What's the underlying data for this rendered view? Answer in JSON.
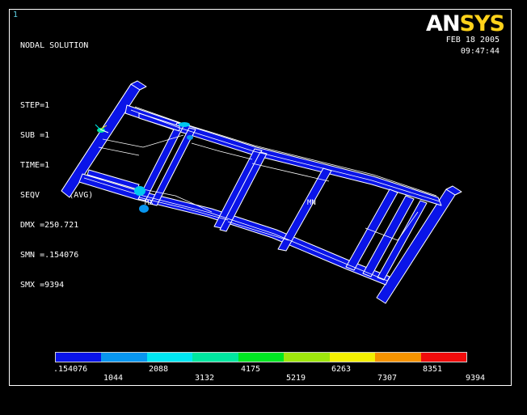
{
  "window_number": "1",
  "logo": {
    "part1": "AN",
    "part2": "SYS"
  },
  "date": "FEB 18 2005",
  "time": "09:47:44",
  "info": [
    "NODAL SOLUTION",
    "",
    "STEP=1",
    "SUB =1",
    "TIME=1",
    "SEQV      (AVG)",
    "DMX =250.721",
    "SMN =.154076",
    "SMX =9394"
  ],
  "markers": {
    "mx": "MX",
    "mn": "MN"
  },
  "legend": {
    "colors": [
      "#0a14e8",
      "#0896ef",
      "#00e6f2",
      "#00e7a0",
      "#00e623",
      "#9ee60d",
      "#f3ef02",
      "#f59300",
      "#f00c0c"
    ],
    "labels_top": [
      ".154076",
      "2088",
      "4175",
      "6263",
      "8351"
    ],
    "labels_bottom": [
      "1044",
      "3132",
      "5219",
      "7307",
      "9394"
    ]
  },
  "colors": {
    "frame": "#0a14e8",
    "edge": "#ffffff",
    "highlight": "#00c8f0"
  }
}
